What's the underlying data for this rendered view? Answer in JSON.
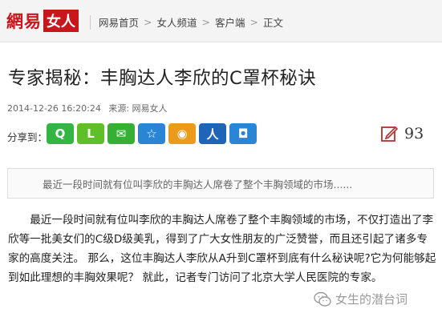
{
  "header": {
    "logo_main": "網易",
    "logo_sub": "女人",
    "breadcrumb": [
      "网易首页",
      "女人频道",
      "客户端",
      "正文"
    ],
    "separator": ">"
  },
  "article": {
    "title": "专家揭秘：丰胸达人李欣的C罩杯秘诀",
    "date": "2014-12-26 16:20:24",
    "source": "来源: 网易女人",
    "share_label": "分享到：",
    "share_buttons": [
      {
        "glyph": "Q",
        "color": "#33b544",
        "icon": "qq-icon"
      },
      {
        "glyph": "L",
        "color": "#5fbf2a",
        "icon": "laiwang-icon"
      },
      {
        "glyph": "✉",
        "color": "#35b034",
        "icon": "wechat-icon"
      },
      {
        "glyph": "☆",
        "color": "#2a86d5",
        "icon": "qzone-icon"
      },
      {
        "glyph": "◉",
        "color": "#eb9a1c",
        "icon": "weibo-icon"
      },
      {
        "glyph": "人",
        "color": "#2064b8",
        "icon": "renren-icon"
      },
      {
        "glyph": "◘",
        "color": "#2a86d5",
        "icon": "youdao-icon"
      }
    ],
    "comment_count": "93",
    "summary": "最近一段时间就有位叫李欣的丰胸达人席卷了整个丰胸领域的市场......",
    "body": "最近一段时间就有位叫李欣的丰胸达人席卷了整个丰胸领域的市场，不仅打造出了李欣等一批美女们的C级D级美乳，得到了广大女性朋友的广泛赞誉，而且还引起了诸多专家的高度关注。 那么，这位丰胸达人李欣从A升到C罩杯到底有什么秘诀呢?它为何能够起到如此理想的丰胸效果呢？ 就此，记者专门访问了北京大学人民医院的专家。"
  },
  "watermark": {
    "text": "女生的潜台词"
  }
}
